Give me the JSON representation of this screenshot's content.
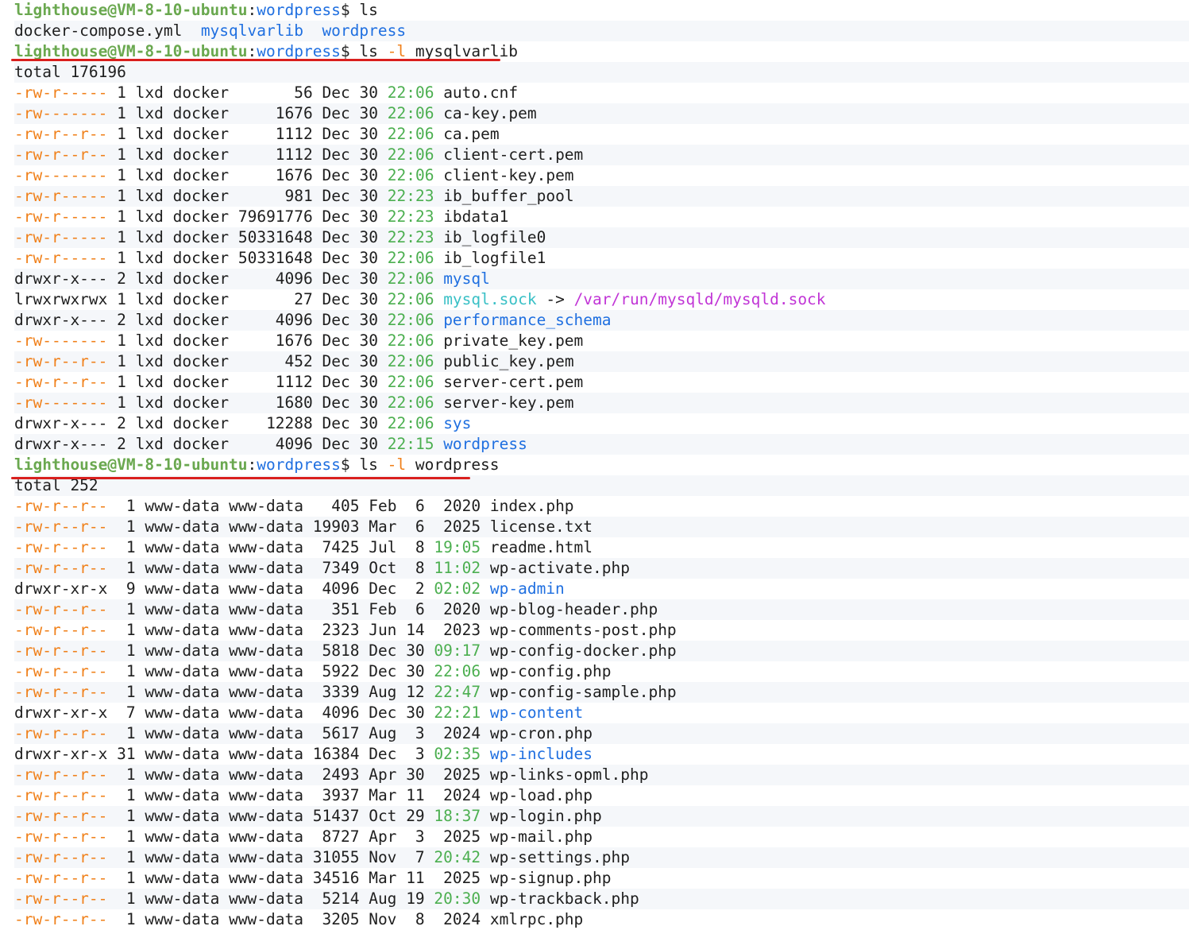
{
  "prompt": {
    "user": "lighthouse@VM-8-10-ubuntu",
    "path": "wordpress",
    "symbol": "$"
  },
  "commands": [
    {
      "cmd": "ls",
      "flag": "",
      "arg": ""
    },
    {
      "cmd": "ls",
      "flag": "-l",
      "arg": "mysqlvarlib"
    },
    {
      "cmd": "ls",
      "flag": "-l",
      "arg": "wordpress"
    }
  ],
  "ls_output": [
    "docker-compose.yml",
    "mysqlvarlib",
    "wordpress"
  ],
  "listing_mysql": {
    "total": "total 176196",
    "rows": [
      [
        "-rw-r-----",
        "1",
        "lxd",
        "docker",
        "56",
        "Dec",
        "30",
        "22:06",
        "auto.cnf",
        "file",
        ""
      ],
      [
        "-rw-------",
        "1",
        "lxd",
        "docker",
        "1676",
        "Dec",
        "30",
        "22:06",
        "ca-key.pem",
        "file",
        ""
      ],
      [
        "-rw-r--r--",
        "1",
        "lxd",
        "docker",
        "1112",
        "Dec",
        "30",
        "22:06",
        "ca.pem",
        "file",
        ""
      ],
      [
        "-rw-r--r--",
        "1",
        "lxd",
        "docker",
        "1112",
        "Dec",
        "30",
        "22:06",
        "client-cert.pem",
        "file",
        ""
      ],
      [
        "-rw-------",
        "1",
        "lxd",
        "docker",
        "1676",
        "Dec",
        "30",
        "22:06",
        "client-key.pem",
        "file",
        ""
      ],
      [
        "-rw-r-----",
        "1",
        "lxd",
        "docker",
        "981",
        "Dec",
        "30",
        "22:23",
        "ib_buffer_pool",
        "file",
        ""
      ],
      [
        "-rw-r-----",
        "1",
        "lxd",
        "docker",
        "79691776",
        "Dec",
        "30",
        "22:23",
        "ibdata1",
        "file",
        ""
      ],
      [
        "-rw-r-----",
        "1",
        "lxd",
        "docker",
        "50331648",
        "Dec",
        "30",
        "22:23",
        "ib_logfile0",
        "file",
        ""
      ],
      [
        "-rw-r-----",
        "1",
        "lxd",
        "docker",
        "50331648",
        "Dec",
        "30",
        "22:06",
        "ib_logfile1",
        "file",
        ""
      ],
      [
        "drwxr-x---",
        "2",
        "lxd",
        "docker",
        "4096",
        "Dec",
        "30",
        "22:06",
        "mysql",
        "dir",
        ""
      ],
      [
        "lrwxrwxrwx",
        "1",
        "lxd",
        "docker",
        "27",
        "Dec",
        "30",
        "22:06",
        "mysql.sock",
        "link",
        "/var/run/mysqld/mysqld.sock"
      ],
      [
        "drwxr-x---",
        "2",
        "lxd",
        "docker",
        "4096",
        "Dec",
        "30",
        "22:06",
        "performance_schema",
        "dir",
        ""
      ],
      [
        "-rw-------",
        "1",
        "lxd",
        "docker",
        "1676",
        "Dec",
        "30",
        "22:06",
        "private_key.pem",
        "file",
        ""
      ],
      [
        "-rw-r--r--",
        "1",
        "lxd",
        "docker",
        "452",
        "Dec",
        "30",
        "22:06",
        "public_key.pem",
        "file",
        ""
      ],
      [
        "-rw-r--r--",
        "1",
        "lxd",
        "docker",
        "1112",
        "Dec",
        "30",
        "22:06",
        "server-cert.pem",
        "file",
        ""
      ],
      [
        "-rw-------",
        "1",
        "lxd",
        "docker",
        "1680",
        "Dec",
        "30",
        "22:06",
        "server-key.pem",
        "file",
        ""
      ],
      [
        "drwxr-x---",
        "2",
        "lxd",
        "docker",
        "12288",
        "Dec",
        "30",
        "22:06",
        "sys",
        "dir",
        ""
      ],
      [
        "drwxr-x---",
        "2",
        "lxd",
        "docker",
        "4096",
        "Dec",
        "30",
        "22:15",
        "wordpress",
        "dir",
        ""
      ]
    ]
  },
  "listing_wp": {
    "total": "total 252",
    "rows": [
      [
        "-rw-r--r--",
        "1",
        "www-data",
        "www-data",
        "405",
        "Feb",
        "6",
        "2020",
        "index.php",
        "file",
        ""
      ],
      [
        "-rw-r--r--",
        "1",
        "www-data",
        "www-data",
        "19903",
        "Mar",
        "6",
        "2025",
        "license.txt",
        "file",
        ""
      ],
      [
        "-rw-r--r--",
        "1",
        "www-data",
        "www-data",
        "7425",
        "Jul",
        "8",
        "19:05",
        "readme.html",
        "file",
        ""
      ],
      [
        "-rw-r--r--",
        "1",
        "www-data",
        "www-data",
        "7349",
        "Oct",
        "8",
        "11:02",
        "wp-activate.php",
        "file",
        ""
      ],
      [
        "drwxr-xr-x",
        "9",
        "www-data",
        "www-data",
        "4096",
        "Dec",
        "2",
        "02:02",
        "wp-admin",
        "dir",
        ""
      ],
      [
        "-rw-r--r--",
        "1",
        "www-data",
        "www-data",
        "351",
        "Feb",
        "6",
        "2020",
        "wp-blog-header.php",
        "file",
        ""
      ],
      [
        "-rw-r--r--",
        "1",
        "www-data",
        "www-data",
        "2323",
        "Jun",
        "14",
        "2023",
        "wp-comments-post.php",
        "file",
        ""
      ],
      [
        "-rw-r--r--",
        "1",
        "www-data",
        "www-data",
        "5818",
        "Dec",
        "30",
        "09:17",
        "wp-config-docker.php",
        "file",
        ""
      ],
      [
        "-rw-r--r--",
        "1",
        "www-data",
        "www-data",
        "5922",
        "Dec",
        "30",
        "22:06",
        "wp-config.php",
        "file",
        ""
      ],
      [
        "-rw-r--r--",
        "1",
        "www-data",
        "www-data",
        "3339",
        "Aug",
        "12",
        "22:47",
        "wp-config-sample.php",
        "file",
        ""
      ],
      [
        "drwxr-xr-x",
        "7",
        "www-data",
        "www-data",
        "4096",
        "Dec",
        "30",
        "22:21",
        "wp-content",
        "dir",
        ""
      ],
      [
        "-rw-r--r--",
        "1",
        "www-data",
        "www-data",
        "5617",
        "Aug",
        "3",
        "2024",
        "wp-cron.php",
        "file",
        ""
      ],
      [
        "drwxr-xr-x",
        "31",
        "www-data",
        "www-data",
        "16384",
        "Dec",
        "3",
        "02:35",
        "wp-includes",
        "dir",
        ""
      ],
      [
        "-rw-r--r--",
        "1",
        "www-data",
        "www-data",
        "2493",
        "Apr",
        "30",
        "2025",
        "wp-links-opml.php",
        "file",
        ""
      ],
      [
        "-rw-r--r--",
        "1",
        "www-data",
        "www-data",
        "3937",
        "Mar",
        "11",
        "2024",
        "wp-load.php",
        "file",
        ""
      ],
      [
        "-rw-r--r--",
        "1",
        "www-data",
        "www-data",
        "51437",
        "Oct",
        "29",
        "18:37",
        "wp-login.php",
        "file",
        ""
      ],
      [
        "-rw-r--r--",
        "1",
        "www-data",
        "www-data",
        "8727",
        "Apr",
        "3",
        "2025",
        "wp-mail.php",
        "file",
        ""
      ],
      [
        "-rw-r--r--",
        "1",
        "www-data",
        "www-data",
        "31055",
        "Nov",
        "7",
        "20:42",
        "wp-settings.php",
        "file",
        ""
      ],
      [
        "-rw-r--r--",
        "1",
        "www-data",
        "www-data",
        "34516",
        "Mar",
        "11",
        "2025",
        "wp-signup.php",
        "file",
        ""
      ],
      [
        "-rw-r--r--",
        "1",
        "www-data",
        "www-data",
        "5214",
        "Aug",
        "19",
        "20:30",
        "wp-trackback.php",
        "file",
        ""
      ],
      [
        "-rw-r--r--",
        "1",
        "www-data",
        "www-data",
        "3205",
        "Nov",
        "8",
        "2024",
        "xmlrpc.php",
        "file",
        ""
      ]
    ]
  },
  "colors": {
    "prompt_user": "#6aa84f",
    "prompt_path": "#1f6fe0",
    "permissions": "#f0801a",
    "time": "#4caf50",
    "directory": "#1f6fe0",
    "symlink": "#39c0c6",
    "symlink_target": "#c135d6",
    "underline": "#d9201e"
  }
}
